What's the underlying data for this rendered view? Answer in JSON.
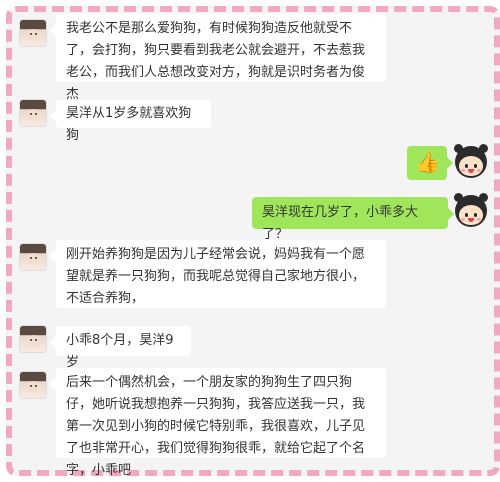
{
  "messages": [
    {
      "side": "left",
      "text": "我老公不是那么爱狗狗，有时候狗狗造反他就受不了，会打狗，狗只要看到我老公就会避开，不去惹我老公，而我们人总想改变对方，狗就是识时务者为俊杰"
    },
    {
      "side": "left",
      "text": "昊洋从1岁多就喜欢狗狗"
    },
    {
      "side": "right",
      "text": "👍",
      "icon": "thumbs-up-icon"
    },
    {
      "side": "right",
      "text": "昊洋现在几岁了，小乖多大了？"
    },
    {
      "side": "left",
      "text": "刚开始养狗狗是因为儿子经常会说，妈妈我有一个愿望就是养一只狗狗，而我呢总觉得自己家地方很小，不适合养狗，"
    },
    {
      "side": "left",
      "text": "小乖8个月，昊洋9岁"
    },
    {
      "side": "left",
      "text": "后来一个偶然机会，一个朋友家的狗狗生了四只狗仔，她听说我想抱养一只狗狗，我答应送我一只，我第一次见到小狗的时候它特别乖，我很喜欢，儿子见了也非常开心，我们觉得狗狗很乖，就给它起了个名字，小乖吧"
    }
  ],
  "colors": {
    "frame_border": "#f2a7c3",
    "background": "#f4f4f4",
    "own_bubble": "#9fe65a",
    "other_bubble": "#ffffff"
  }
}
